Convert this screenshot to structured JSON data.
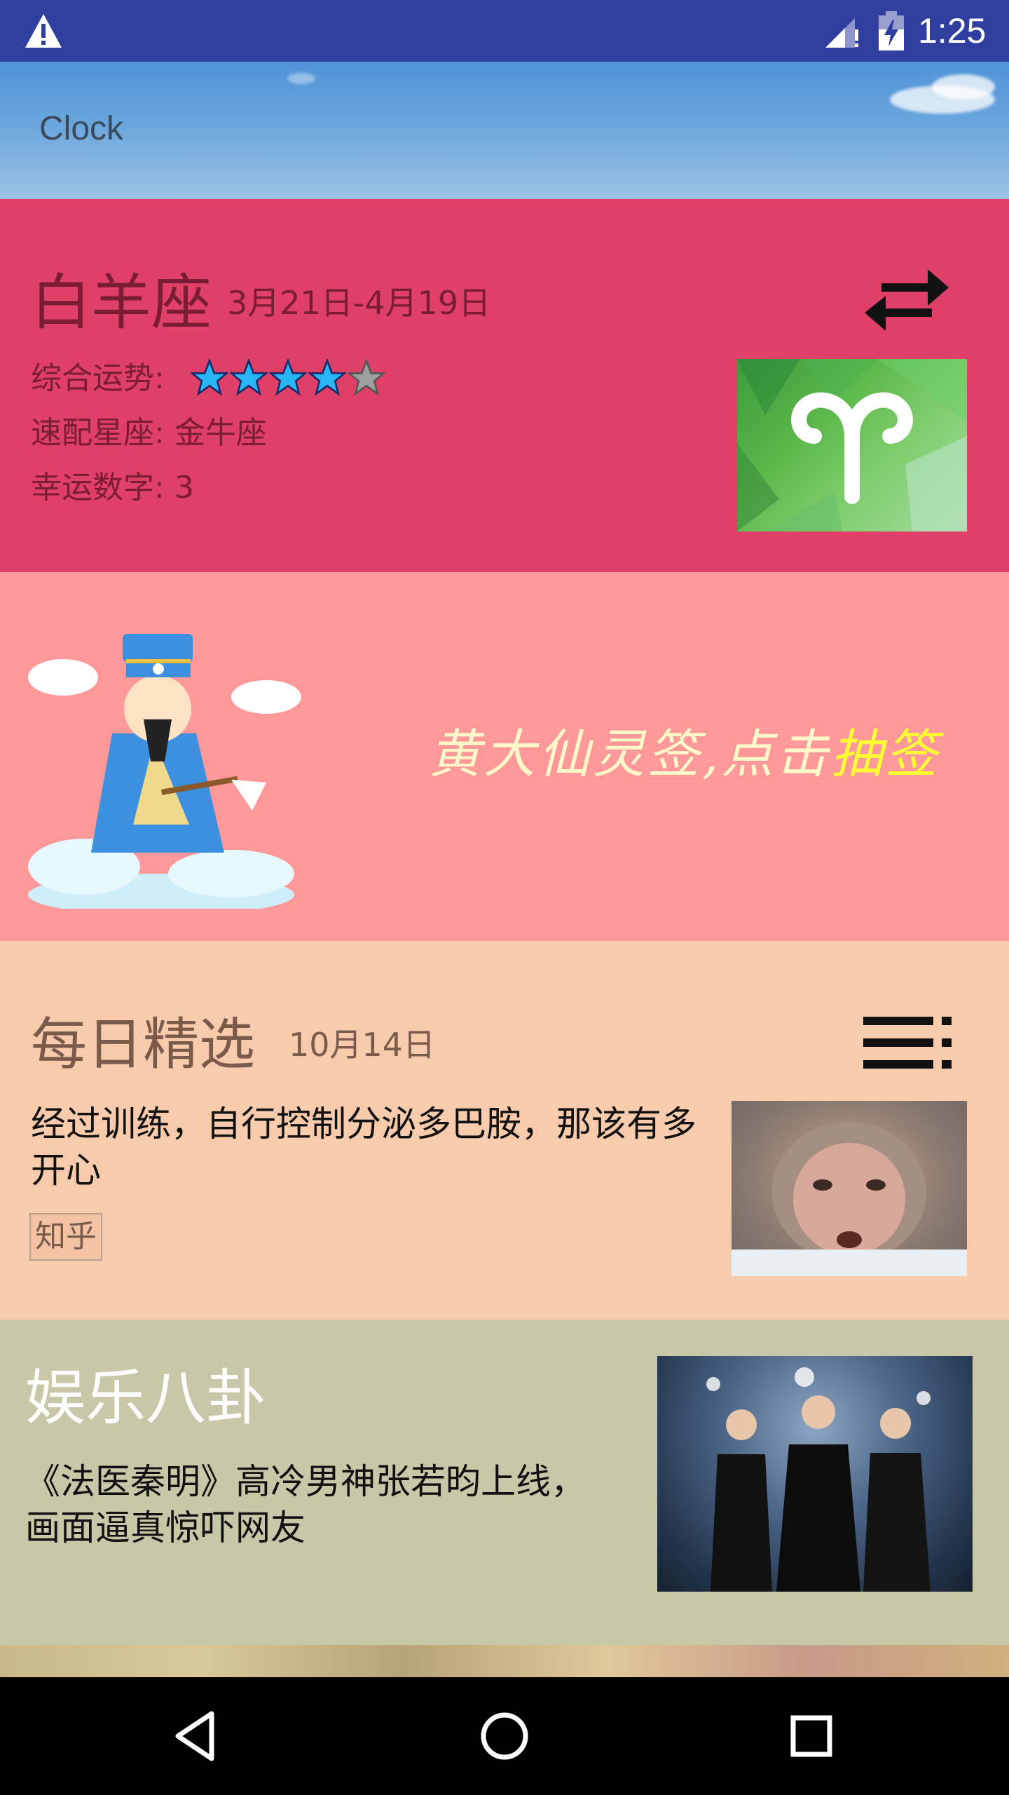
{
  "status_bar": {
    "time": "1:25",
    "icons": [
      "warning-icon",
      "signal-icon",
      "battery-charging-icon"
    ],
    "bg_color": "#303F9F"
  },
  "app_bar": {
    "title": "Clock"
  },
  "horoscope": {
    "sign_name": "白羊座",
    "date_range": "3月21日-4月19日",
    "overall_label": "综合运势:",
    "overall_rating": 4,
    "overall_max": 5,
    "match_label": "速配星座:",
    "match_value": "金牛座",
    "lucky_label": "幸运数字:",
    "lucky_value": "3",
    "switch_icon": "swap-arrows-icon",
    "bg_color": "#E04068"
  },
  "lottery": {
    "text_main": "黄大仙灵签,点击",
    "text_highlight": "抽签",
    "bg_color": "#FF9999"
  },
  "daily_pick": {
    "title": "每日精选",
    "date": "10月14日",
    "headline": "经过训练，自行控制分泌多巴胺，那该有多开心",
    "source": "知乎",
    "menu_icon": "list-icon",
    "bg_color": "#F8CBAD"
  },
  "entertainment": {
    "title": "娱乐八卦",
    "headline": "《法医秦明》高冷男神张若昀上线，画面逼真惊吓网友",
    "bg_color": "#C8C8A9"
  },
  "nav_bar": {
    "buttons": [
      "back-icon",
      "home-icon",
      "recents-icon"
    ]
  }
}
